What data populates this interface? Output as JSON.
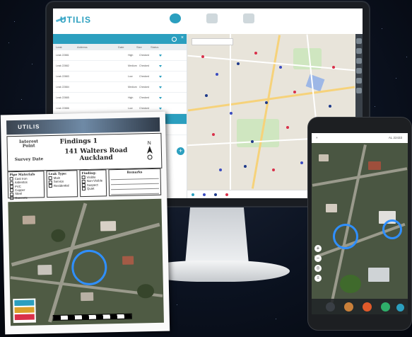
{
  "monitor_app": {
    "logo": "UTILIS",
    "top_tabs": [
      "",
      "",
      ""
    ],
    "user_link": "",
    "panel_title": "",
    "panel_badge": "",
    "columns": [
      "Leak",
      "Address",
      "Date",
      "Size",
      "Status"
    ],
    "rows": [
      {
        "id": "Leak 22881",
        "addr": "",
        "date": "",
        "size": "High",
        "status": "Checked",
        "selected": false
      },
      {
        "id": "Leak 22882",
        "addr": "",
        "date": "",
        "size": "Medium",
        "status": "Checked",
        "selected": false
      },
      {
        "id": "Leak 22883",
        "addr": "",
        "date": "",
        "size": "Low",
        "status": "Checked",
        "selected": false
      },
      {
        "id": "Leak 22884",
        "addr": "",
        "date": "",
        "size": "Medium",
        "status": "Checked",
        "selected": false
      },
      {
        "id": "Leak 22885",
        "addr": "",
        "date": "",
        "size": "High",
        "status": "Checked",
        "selected": false
      },
      {
        "id": "Leak 22886",
        "addr": "",
        "date": "",
        "size": "Low",
        "status": "Checked",
        "selected": false
      },
      {
        "id": "Leak 22887",
        "addr": "",
        "date": "",
        "size": "Medium",
        "status": "Checked",
        "selected": true
      },
      {
        "id": "Leak 22888",
        "addr": "",
        "date": "",
        "size": "",
        "status": "",
        "selected": false
      }
    ],
    "legend": [
      {
        "label": "",
        "color": "#2b9fbf"
      },
      {
        "label": "",
        "color": "#3b4cc0"
      },
      {
        "label": "",
        "color": "#1e3a8a"
      },
      {
        "label": "",
        "color": "#d9304a"
      }
    ]
  },
  "sheet": {
    "banner": "UTILIS",
    "interest_label": "Interest Point",
    "interest_id": "",
    "date_label": "Survey Date",
    "date_value": "",
    "finding": "Findings 1",
    "address_line1": "141 Walters Road",
    "address_line2": "Auckland",
    "pipe_title": "Pipe Materials",
    "pipe_items": [
      "Cast Iron",
      "Asbestos",
      "PVC",
      "Copper",
      "Steel",
      "Concrete"
    ],
    "leak_title": "Leak Type:",
    "leak_items": [
      "Main",
      "Service",
      "Residential"
    ],
    "finding_title": "Finding:",
    "finding_items": [
      "Visible",
      "Non-Visible",
      "Suspect",
      "Quiet"
    ],
    "remarks_title": "Remarks",
    "legend_items": [
      "",
      "",
      ""
    ]
  },
  "phone": {
    "close": "×",
    "title": "AL 22433",
    "zoom_in": "+",
    "zoom_out": "−"
  },
  "colors": {
    "accent": "#2b9fbf",
    "selected_row": "#2b9fbf",
    "highlight_circle": "#2f8fff"
  }
}
